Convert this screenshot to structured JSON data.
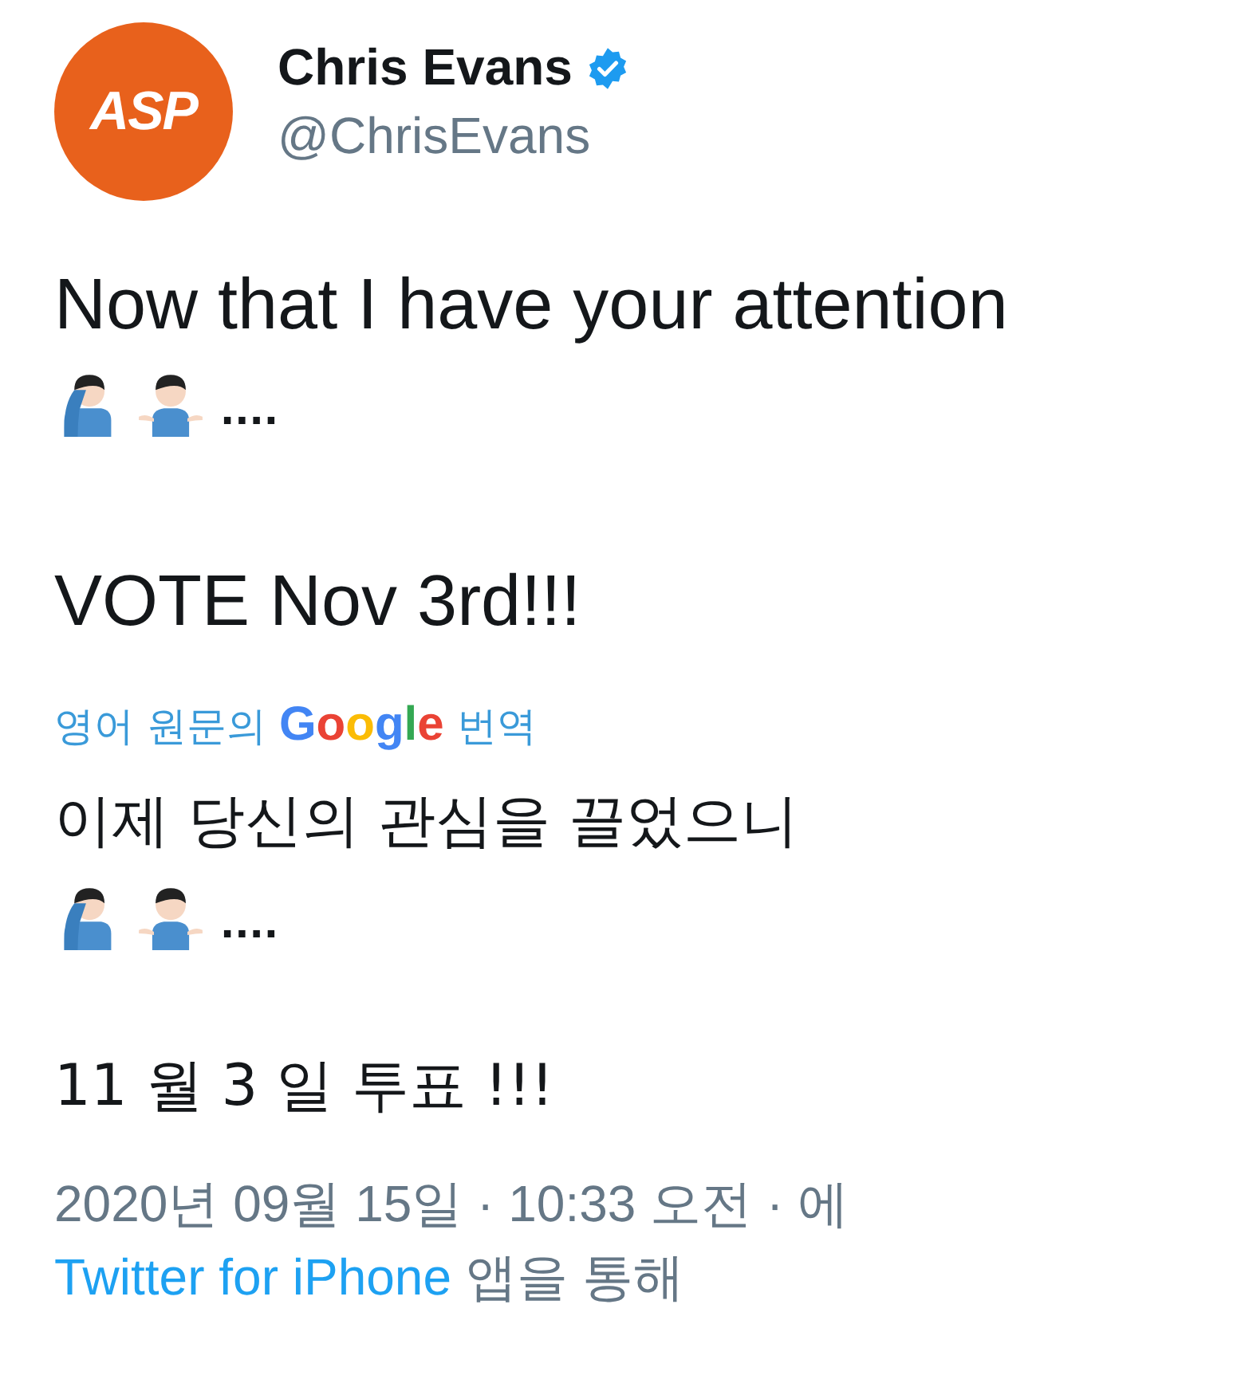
{
  "author": {
    "avatar_text": "ASP",
    "name": "Chris Evans",
    "verified": true,
    "handle": "@ChrisEvans"
  },
  "tweet": {
    "lines": [
      {
        "kind": "text",
        "text": "Now that I have your attention"
      },
      {
        "kind": "emoji",
        "text": "...."
      },
      {
        "kind": "gap"
      },
      {
        "kind": "text",
        "text": "VOTE Nov 3rd!!!"
      }
    ]
  },
  "translation": {
    "label_before": "영어 원문의",
    "logo": "Google",
    "label_after": "번역",
    "lines": [
      {
        "kind": "text",
        "text": "이제 당신의 관심을 끌었으니"
      },
      {
        "kind": "emoji",
        "text": "...."
      },
      {
        "kind": "gap"
      },
      {
        "kind": "text",
        "text": " 11 월 3 일 투표 !!!"
      }
    ]
  },
  "footer": {
    "timestamp": "2020년 09월 15일 · 10:33 오전 · 에",
    "source": "Twitter for iPhone",
    "suffix": "앱을 통해"
  }
}
